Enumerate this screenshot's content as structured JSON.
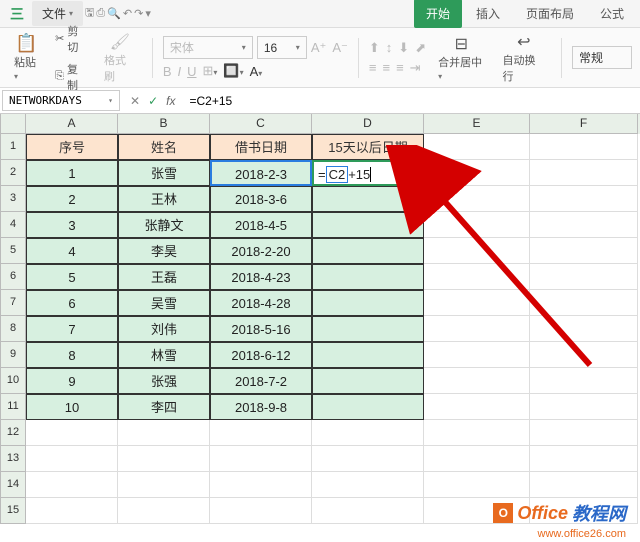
{
  "menubar": {
    "file": "文件",
    "tabs": {
      "start": "开始",
      "insert": "插入",
      "layout": "页面布局",
      "formula": "公式"
    }
  },
  "ribbon": {
    "cut": "剪切",
    "copy": "复制",
    "paste": "粘贴",
    "format_painter": "格式刷",
    "font_name": "宋体",
    "font_size": "16",
    "merge": "合并居中",
    "wrap": "自动换行",
    "number_format": "常规"
  },
  "formula_bar": {
    "name_box": "NETWORKDAYS",
    "formula": "=C2+15"
  },
  "headers": {
    "A": "序号",
    "B": "姓名",
    "C": "借书日期",
    "D": "15天以后日期"
  },
  "editing_cell": {
    "prefix": "=",
    "ref": "C2",
    "suffix": "+15"
  },
  "chart_data": {
    "type": "table",
    "columns": [
      "序号",
      "姓名",
      "借书日期",
      "15天以后日期"
    ],
    "rows": [
      {
        "序号": 1,
        "姓名": "张雪",
        "借书日期": "2018-2-3",
        "15天以后日期": "= C2 +15"
      },
      {
        "序号": 2,
        "姓名": "王林",
        "借书日期": "2018-3-6",
        "15天以后日期": ""
      },
      {
        "序号": 3,
        "姓名": "张静文",
        "借书日期": "2018-4-5",
        "15天以后日期": ""
      },
      {
        "序号": 4,
        "姓名": "李昊",
        "借书日期": "2018-2-20",
        "15天以后日期": ""
      },
      {
        "序号": 5,
        "姓名": "王磊",
        "借书日期": "2018-4-23",
        "15天以后日期": ""
      },
      {
        "序号": 6,
        "姓名": "吴雪",
        "借书日期": "2018-4-28",
        "15天以后日期": ""
      },
      {
        "序号": 7,
        "姓名": "刘伟",
        "借书日期": "2018-5-16",
        "15天以后日期": ""
      },
      {
        "序号": 8,
        "姓名": "林雪",
        "借书日期": "2018-6-12",
        "15天以后日期": ""
      },
      {
        "序号": 9,
        "姓名": "张强",
        "借书日期": "2018-7-2",
        "15天以后日期": ""
      },
      {
        "序号": 10,
        "姓名": "李四",
        "借书日期": "2018-9-8",
        "15天以后日期": ""
      }
    ]
  },
  "watermark": {
    "brand1": "Office",
    "brand2": "教程网",
    "url": "www.office26.com"
  },
  "cols": [
    "A",
    "B",
    "C",
    "D",
    "E",
    "F"
  ],
  "row_nums": [
    "1",
    "2",
    "3",
    "4",
    "5",
    "6",
    "7",
    "8",
    "9",
    "10",
    "11",
    "12",
    "13",
    "14",
    "15"
  ]
}
